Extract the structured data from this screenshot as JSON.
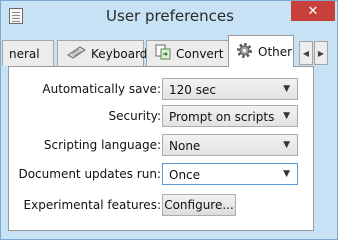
{
  "window": {
    "title": "User preferences",
    "close_glyph": "✕",
    "icon": "document-icon"
  },
  "tabs": [
    {
      "label": "neral",
      "icon": null,
      "active": false
    },
    {
      "label": "Keyboard",
      "icon": "keyboard-icon",
      "active": false
    },
    {
      "label": "Convert",
      "icon": "convert-icon",
      "active": false
    },
    {
      "label": "Other",
      "icon": "gear-icon",
      "active": true
    }
  ],
  "tab_scroll": {
    "left": "◀",
    "right": "▶"
  },
  "settings": {
    "autosave": {
      "label": "Automatically save:",
      "value": "120 sec"
    },
    "security": {
      "label": "Security:",
      "value": "Prompt on scripts"
    },
    "scripting": {
      "label": "Scripting language:",
      "value": "None"
    },
    "doc_updates": {
      "label": "Document updates run:",
      "value": "Once"
    },
    "experimental": {
      "label": "Experimental features:",
      "button": "Configure..."
    }
  },
  "dropdown_arrow": "▼",
  "colors": {
    "titlebar": "#c8e2f5",
    "close_button": "#c7413a",
    "focus_border": "#5b9bd5"
  }
}
